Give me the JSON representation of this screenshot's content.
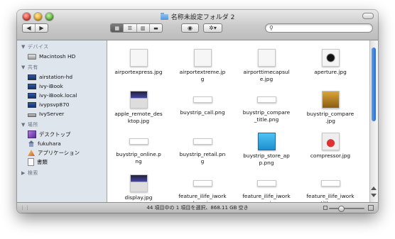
{
  "window": {
    "title": "名称未設定フォルダ 2"
  },
  "toolbar": {
    "back": "◀",
    "forward": "▶",
    "view_icons": [
      "▦",
      "☰",
      "▥",
      "▬"
    ],
    "eye": "◉",
    "gear": "✲▾",
    "search_value": ""
  },
  "sidebar": {
    "sections": [
      {
        "header": "デバイス",
        "items": [
          {
            "label": "Macintosh HD",
            "icon": "hard-drive-icon"
          }
        ]
      },
      {
        "header": "共有",
        "items": [
          {
            "label": "airstation-hd",
            "icon": "monitor-icon"
          },
          {
            "label": "ivy-iBook",
            "icon": "monitor-icon"
          },
          {
            "label": "ivy-iBook.local",
            "icon": "monitor-icon"
          },
          {
            "label": "ivypsvp870",
            "icon": "monitor-icon"
          },
          {
            "label": "IvyServer",
            "icon": "server-icon"
          }
        ]
      },
      {
        "header": "場所",
        "items": [
          {
            "label": "デスクトップ",
            "icon": "desktop-icon"
          },
          {
            "label": "fukuhara",
            "icon": "home-icon"
          },
          {
            "label": "アプリケーション",
            "icon": "applications-icon"
          },
          {
            "label": "書類",
            "icon": "documents-icon"
          }
        ]
      },
      {
        "header": "検索",
        "items": []
      }
    ]
  },
  "files": [
    {
      "name": "airportexpress.jpg",
      "thumb": "pale"
    },
    {
      "name": "airportextreme.jp\ng",
      "thumb": "pale"
    },
    {
      "name": "airporttimecapsul\ne.jpg",
      "thumb": "pale"
    },
    {
      "name": "aperture.jpg",
      "thumb": "dark"
    },
    {
      "name": "apple_remote_des\nktop.jpg",
      "thumb": "monitor"
    },
    {
      "name": "buystrip_call.png",
      "thumb": "wide"
    },
    {
      "name": "buystrip_compare\n_title.png",
      "thumb": "wide"
    },
    {
      "name": "buystrip_compare\n.jpg",
      "thumb": "gold"
    },
    {
      "name": "buystrip_online.p\nng",
      "thumb": "wide"
    },
    {
      "name": "buystrip_retail.pn\ng",
      "thumb": "wide"
    },
    {
      "name": "buystrip_store_ap\np.png",
      "thumb": "blue"
    },
    {
      "name": "compressor.jpg",
      "thumb": "can"
    },
    {
      "name": "display.jpg",
      "thumb": "monitor"
    },
    {
      "name": "feature_ilife_iwork\n_hero.jpg",
      "thumb": "wide"
    },
    {
      "name": "feature_ilife_iwork\n_new.jpg",
      "thumb": "wide"
    },
    {
      "name": "feature_ilife_iwork\n_title.png",
      "thumb": "wide"
    }
  ],
  "status": {
    "text": "44 項目中の 1 項目を選択、868.11 GB 空き",
    "icon_size_level": 0.3
  },
  "colors": {
    "selection_blue": "#2a6fcf",
    "sidebar_bg": "#dfe5ec"
  }
}
